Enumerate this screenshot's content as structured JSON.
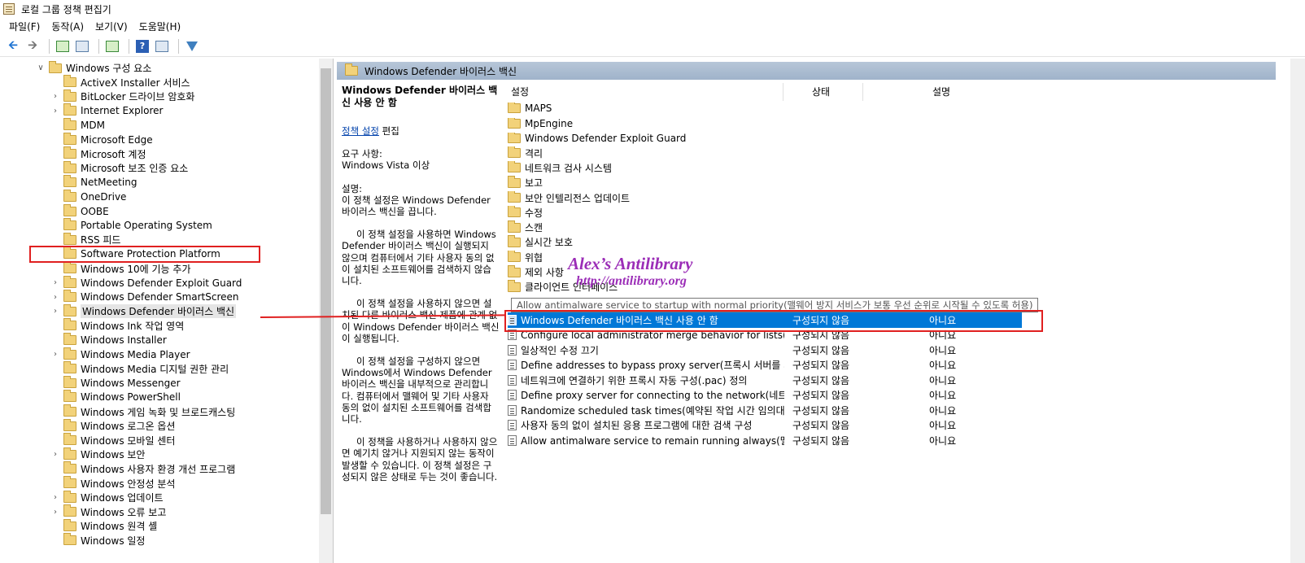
{
  "window": {
    "title": "로컬 그룹 정책 편집기"
  },
  "menu": [
    "파일(F)",
    "동작(A)",
    "보기(V)",
    "도움말(H)"
  ],
  "toolbar": {
    "icons": [
      "back-arrow-icon",
      "forward-arrow-icon",
      "up-folder-icon",
      "show-hide-tree-icon",
      "export-list-icon",
      "help-icon",
      "properties-icon",
      "filter-icon"
    ]
  },
  "tree": {
    "parent": "Windows 구성 요소",
    "items": [
      {
        "label": "ActiveX Installer 서비스",
        "expandable": false
      },
      {
        "label": "BitLocker 드라이브 암호화",
        "expandable": true
      },
      {
        "label": "Internet Explorer",
        "expandable": true
      },
      {
        "label": "MDM",
        "expandable": false
      },
      {
        "label": "Microsoft Edge",
        "expandable": false
      },
      {
        "label": "Microsoft 계정",
        "expandable": false
      },
      {
        "label": "Microsoft 보조 인증 요소",
        "expandable": false
      },
      {
        "label": "NetMeeting",
        "expandable": false
      },
      {
        "label": "OneDrive",
        "expandable": false
      },
      {
        "label": "OOBE",
        "expandable": false
      },
      {
        "label": "Portable Operating System",
        "expandable": false
      },
      {
        "label": "RSS 피드",
        "expandable": false
      },
      {
        "label": "Software Protection Platform",
        "expandable": false
      },
      {
        "label": "Windows 10에 기능 추가",
        "expandable": false
      },
      {
        "label": "Windows Defender Exploit Guard",
        "expandable": true
      },
      {
        "label": "Windows Defender SmartScreen",
        "expandable": true
      },
      {
        "label": "Windows Defender 바이러스 백신",
        "expandable": true,
        "selected": true
      },
      {
        "label": "Windows Ink 작업 영역",
        "expandable": false
      },
      {
        "label": "Windows Installer",
        "expandable": false
      },
      {
        "label": "Windows Media Player",
        "expandable": true
      },
      {
        "label": "Windows Media 디지털 권한 관리",
        "expandable": false
      },
      {
        "label": "Windows Messenger",
        "expandable": false
      },
      {
        "label": "Windows PowerShell",
        "expandable": false
      },
      {
        "label": "Windows 게임 녹화 및 브로드캐스팅",
        "expandable": false
      },
      {
        "label": "Windows 로그온 옵션",
        "expandable": false
      },
      {
        "label": "Windows 모바일 센터",
        "expandable": false
      },
      {
        "label": "Windows 보안",
        "expandable": true
      },
      {
        "label": "Windows 사용자 환경 개선 프로그램",
        "expandable": false
      },
      {
        "label": "Windows 안정성 분석",
        "expandable": false
      },
      {
        "label": "Windows 업데이트",
        "expandable": true
      },
      {
        "label": "Windows 오류 보고",
        "expandable": true
      },
      {
        "label": "Windows 원격 셸",
        "expandable": false
      },
      {
        "label": "Windows 일정",
        "expandable": false
      }
    ]
  },
  "right": {
    "header": "Windows Defender 바이러스 백신",
    "desc": {
      "title": "Windows Defender 바이러스 백신 사용 안 함",
      "edit_link": "정책 설정",
      "edit_suffix": " 편집",
      "req_label": "요구 사항:",
      "req_value": "Windows Vista 이상",
      "desc_label": "설명:",
      "p1": "이 정책 설정은 Windows Defender 바이러스 백신을 끕니다.",
      "p2": "이 정책 설정을 사용하면 Windows Defender 바이러스 백신이 실행되지 않으며 컴퓨터에서 기타 사용자 동의 없이 설치된 소프트웨어를 검색하지 않습니다.",
      "p3": "이 정책 설정을 사용하지 않으면 설치된 다른 바이러스 백신 제품에 관계 없이 Windows Defender 바이러스 백신이 실행됩니다.",
      "p4": "이 정책 설정을 구성하지 않으면 Windows에서 Windows Defender 바이러스 백신을 내부적으로 관리합니다. 컴퓨터에서 맬웨어 및 기타 사용자 동의 없이 설치된 소프트웨어를 검색합니다.",
      "p5": "이 정책을 사용하거나 사용하지 않으면 예기치 않거나 지원되지 않는 동작이 발생할 수 있습니다. 이 정책 설정은 구성되지 않은 상태로 두는 것이 좋습니다."
    },
    "columns": {
      "setting": "설정",
      "state": "상태",
      "comment": "설명"
    },
    "folders": [
      "MAPS",
      "MpEngine",
      "Windows Defender Exploit Guard",
      "격리",
      "네트워크 검사 시스템",
      "보고",
      "보안 인텔리전스 업데이트",
      "수정",
      "스캔",
      "실시간 보호",
      "위협",
      "제외 사항",
      "클라이언트 인터페이스"
    ],
    "tooltip": "Allow antimalware service to startup with normal priority(맬웨어 방지 서비스가 보통 우선 순위로 시작될 수 있도록 허용)",
    "settings": [
      {
        "name": "Windows Defender 바이러스 백신 사용 안 함",
        "state": "구성되지 않음",
        "comment": "아니요",
        "selected": true
      },
      {
        "name": "Configure local administrator merge behavior for lists(로컬...",
        "state": "구성되지 않음",
        "comment": "아니요"
      },
      {
        "name": "일상적인 수정 끄기",
        "state": "구성되지 않음",
        "comment": "아니요"
      },
      {
        "name": "Define addresses to bypass proxy server(프록시 서버를 사...",
        "state": "구성되지 않음",
        "comment": "아니요"
      },
      {
        "name": "네트워크에 연결하기 위한 프록시 자동 구성(.pac) 정의",
        "state": "구성되지 않음",
        "comment": "아니요"
      },
      {
        "name": "Define proxy server for connecting to the network(네트워...",
        "state": "구성되지 않음",
        "comment": "아니요"
      },
      {
        "name": "Randomize scheduled task times(예약된 작업 시간 임의대...",
        "state": "구성되지 않음",
        "comment": "아니요"
      },
      {
        "name": "사용자 동의 없이 설치된 응용 프로그램에 대한 검색 구성",
        "state": "구성되지 않음",
        "comment": "아니요"
      },
      {
        "name": "Allow antimalware service to remain running always(맬웨...",
        "state": "구성되지 않음",
        "comment": "아니요"
      }
    ]
  },
  "watermark": {
    "line1": "Alex’s Antilibrary",
    "line2": "http://antilibrary.org"
  },
  "colors": {
    "selection": "#0078d7",
    "highlight_box": "#e02020",
    "header_bar": "#aebfd3",
    "watermark": "#9b2db7"
  }
}
